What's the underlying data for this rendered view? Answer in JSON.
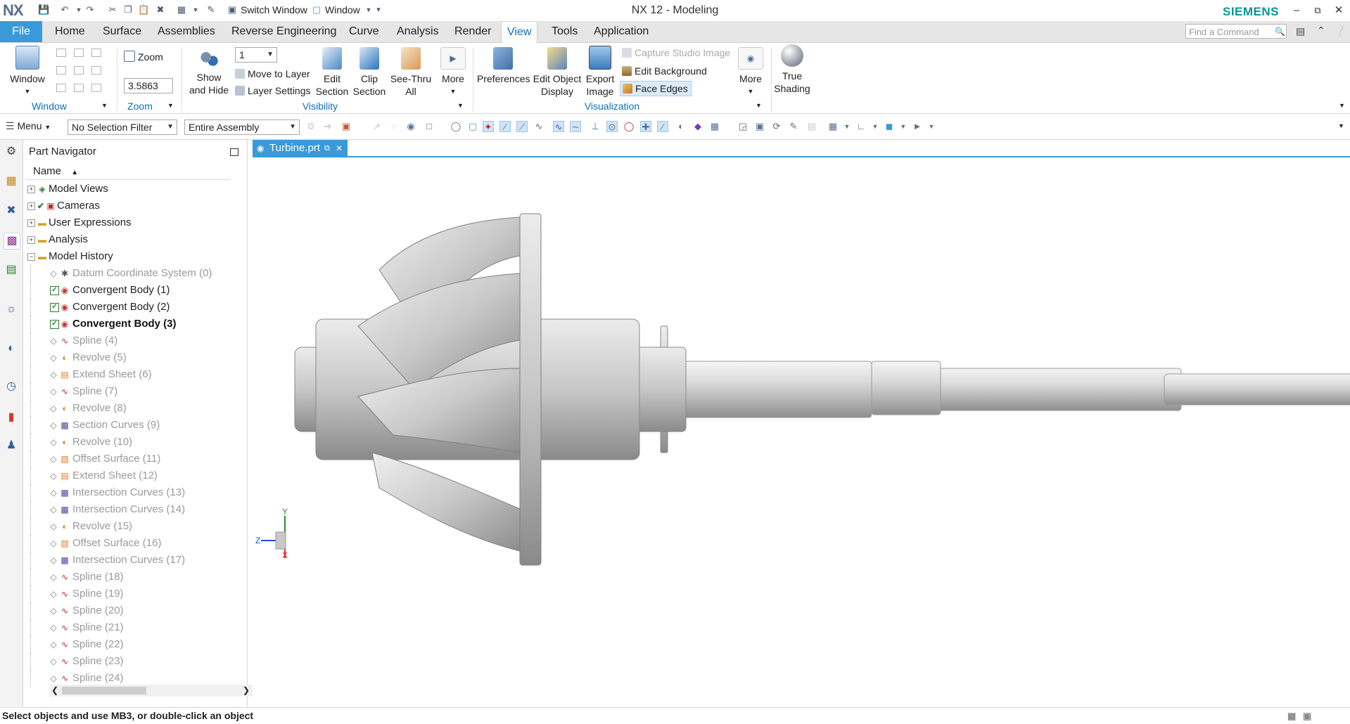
{
  "app": {
    "logo": "NX",
    "title": "NX 12 - Modeling",
    "brand": "SIEMENS",
    "switch_window": "Switch Window",
    "window_menu": "Window"
  },
  "tabs": [
    "File",
    "Home",
    "Surface",
    "Assemblies",
    "Reverse Engineering",
    "Curve",
    "Analysis",
    "Render",
    "View",
    "Tools",
    "Application"
  ],
  "active_tab": "View",
  "find_command_placeholder": "Find a Command",
  "ribbon": {
    "window_btn": "Window",
    "zoom_btn": "Zoom",
    "zoom_value": "3.5863",
    "layer_value": "1",
    "show_hide": [
      "Show",
      "and Hide"
    ],
    "move_to_layer": "Move to Layer",
    "layer_settings": "Layer Settings",
    "edit_section": [
      "Edit",
      "Section"
    ],
    "clip_section": [
      "Clip",
      "Section"
    ],
    "see_thru": [
      "See-Thru",
      "All"
    ],
    "more1": "More",
    "preferences": "Preferences",
    "edit_object_display": [
      "Edit Object",
      "Display"
    ],
    "export_image": [
      "Export",
      "Image"
    ],
    "capture_studio_image": "Capture Studio Image",
    "edit_background": "Edit Background",
    "face_edges": "Face Edges",
    "more2": "More",
    "true_shading": [
      "True",
      "Shading"
    ],
    "groups": {
      "window": "Window",
      "zoom": "Zoom",
      "visibility": "Visibility",
      "visualization": "Visualization"
    }
  },
  "selection_bar": {
    "menu": "Menu",
    "filter": "No Selection Filter",
    "scope": "Entire Assembly"
  },
  "navigator": {
    "title": "Part Navigator",
    "column": "Name",
    "top_items": [
      "Model Views",
      "Cameras",
      "User Expressions",
      "Analysis",
      "Model History"
    ],
    "history": [
      {
        "label": "Datum Coordinate System (0)",
        "state": "gray"
      },
      {
        "label": "Convergent Body (1)",
        "state": "normal"
      },
      {
        "label": "Convergent Body (2)",
        "state": "normal"
      },
      {
        "label": "Convergent Body (3)",
        "state": "bold"
      },
      {
        "label": "Spline (4)",
        "state": "gray"
      },
      {
        "label": "Revolve (5)",
        "state": "gray"
      },
      {
        "label": "Extend Sheet (6)",
        "state": "gray"
      },
      {
        "label": "Spline (7)",
        "state": "gray"
      },
      {
        "label": "Revolve (8)",
        "state": "gray"
      },
      {
        "label": "Section Curves (9)",
        "state": "gray"
      },
      {
        "label": "Revolve (10)",
        "state": "gray"
      },
      {
        "label": "Offset Surface (11)",
        "state": "gray"
      },
      {
        "label": "Extend Sheet (12)",
        "state": "gray"
      },
      {
        "label": "Intersection Curves (13)",
        "state": "gray"
      },
      {
        "label": "Intersection Curves (14)",
        "state": "gray"
      },
      {
        "label": "Revolve (15)",
        "state": "gray"
      },
      {
        "label": "Offset Surface (16)",
        "state": "gray"
      },
      {
        "label": "Intersection Curves (17)",
        "state": "gray"
      },
      {
        "label": "Spline (18)",
        "state": "gray"
      },
      {
        "label": "Spline (19)",
        "state": "gray"
      },
      {
        "label": "Spline (20)",
        "state": "gray"
      },
      {
        "label": "Spline (21)",
        "state": "gray"
      },
      {
        "label": "Spline (22)",
        "state": "gray"
      },
      {
        "label": "Spline (23)",
        "state": "gray"
      },
      {
        "label": "Spline (24)",
        "state": "gray"
      }
    ]
  },
  "graphics": {
    "tab": "Turbine.prt",
    "triad": {
      "y": "Y",
      "z": "Z",
      "x": "X"
    }
  },
  "status_text": "Select objects and use MB3, or double-click an object",
  "colors": {
    "accent": "#3a9ad9",
    "brand": "#009999",
    "check": "#2e7d32"
  }
}
